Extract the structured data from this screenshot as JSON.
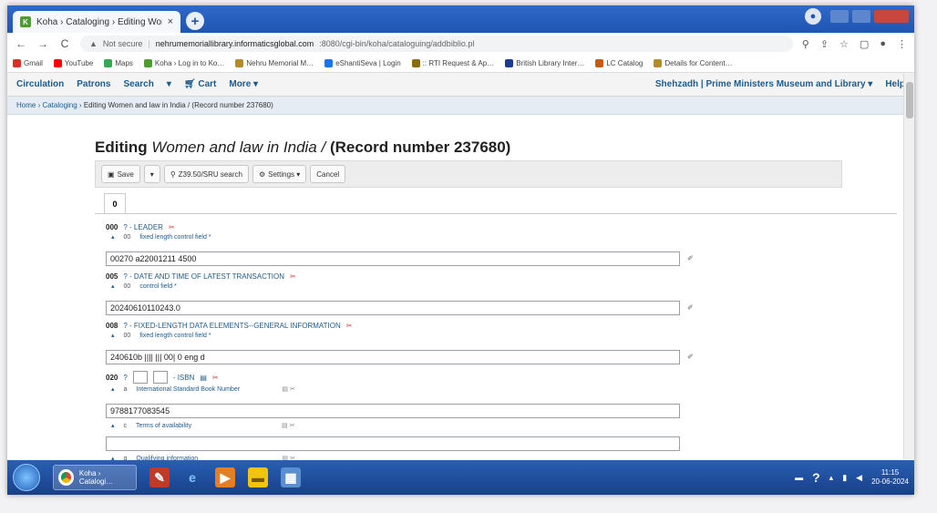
{
  "browser": {
    "tab_title": "Koha › Cataloging › Editing Wor…",
    "tab_close": "×",
    "new_tab": "+",
    "url_security": "Not secure",
    "url_host": "nehrumemoriallibrary.informaticsglobal.com",
    "url_path": ":8080/cgi-bin/koha/cataloguing/addbiblio.pl",
    "nav_back": "←",
    "nav_forward": "→",
    "nav_reload": "C"
  },
  "bookmarks": [
    {
      "label": "Gmail",
      "color": "#d93025"
    },
    {
      "label": "YouTube",
      "color": "#ff0000"
    },
    {
      "label": "Maps",
      "color": "#34a853"
    },
    {
      "label": "Koha › Log in to Ko…",
      "color": "#4a9d2e"
    },
    {
      "label": "Nehru Memorial M…",
      "color": "#b58a2f"
    },
    {
      "label": "eShantiSeva | Login",
      "color": "#1a73e8"
    },
    {
      "label": ":: RTI Request & Ap…",
      "color": "#8a6d00"
    },
    {
      "label": "British Library Inter…",
      "color": "#1a3d8f"
    },
    {
      "label": "LC Catalog",
      "color": "#c55a11"
    },
    {
      "label": "Details for Content…",
      "color": "#b58a2f"
    }
  ],
  "koha_nav": {
    "circulation": "Circulation",
    "patrons": "Patrons",
    "search": "Search",
    "search_caret": "▾",
    "cart": "Cart",
    "more": "More ▾",
    "user": "Shehzadh",
    "library": "Prime Ministers Museum and Library ▾",
    "help": "Help"
  },
  "breadcrumb": {
    "home": "Home",
    "cataloging": "Cataloging",
    "current": "Editing Women and law in India / (Record number 237680)"
  },
  "page": {
    "title_prefix": "Editing ",
    "title_italic": "Women and law in India /",
    "title_suffix": " (Record number 237680)"
  },
  "toolbar": {
    "save": "Save",
    "save_caret": "▾",
    "z3950": "Z39.50/SRU search",
    "settings": "Settings ▾",
    "cancel": "Cancel"
  },
  "tab0": "0",
  "fields": [
    {
      "tag": "000",
      "name": "? - LEADER",
      "sub_code": "00",
      "sub_label": "fixed length control field *",
      "value": "00270   a22001211   4500",
      "editor": "✐"
    },
    {
      "tag": "005",
      "name": "? - DATE AND TIME OF LATEST TRANSACTION",
      "sub_code": "00",
      "sub_label": "control field *",
      "value": "20240610110243.0",
      "editor": "✐"
    },
    {
      "tag": "008",
      "name": "? - FIXED-LENGTH DATA ELEMENTS--GENERAL INFORMATION",
      "sub_code": "00",
      "sub_label": "fixed length control field *",
      "value": "240610b          |||| ||| 00| 0 eng d",
      "editor": "✐"
    },
    {
      "tag": "020",
      "name": "- ISBN",
      "sub_code": "a",
      "sub_label": "International Standard Book Number",
      "value": "9788177083545"
    },
    {
      "sub_code": "c",
      "sub_label": "Terms of availability",
      "value": ""
    },
    {
      "sub_code": "q",
      "sub_label": "Qualifying information"
    }
  ],
  "taskbar": {
    "chrome_label": "Koha › Catalogi…",
    "time": "11:15",
    "date": "20-06-2024"
  }
}
